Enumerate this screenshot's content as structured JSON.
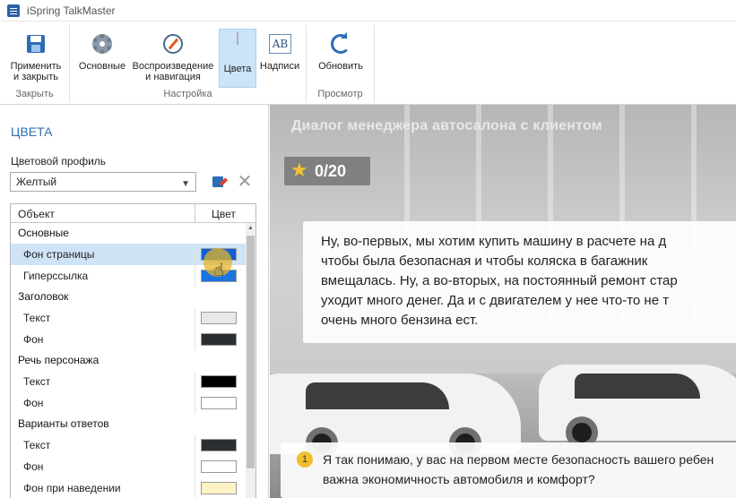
{
  "window": {
    "title": "iSpring TalkMaster",
    "icon": "app-icon"
  },
  "ribbon": {
    "groups": [
      {
        "label": "Закрыть",
        "buttons": [
          {
            "label": "Применить\nи закрыть",
            "icon": "save-close-icon"
          }
        ]
      },
      {
        "label": "Настройка",
        "buttons": [
          {
            "label": "Основные",
            "icon": "gear-icon"
          },
          {
            "label": "Воспроизведение\nи навигация",
            "icon": "compass-icon"
          },
          {
            "label": "Цвета",
            "icon": "colors-icon",
            "active": true
          },
          {
            "label": "Надписи",
            "icon": "text-ab-icon"
          }
        ]
      },
      {
        "label": "Просмотр",
        "buttons": [
          {
            "label": "Обновить",
            "icon": "refresh-icon"
          }
        ]
      }
    ]
  },
  "panel": {
    "title": "ЦВЕТА",
    "profile_label": "Цветовой профиль",
    "profile_value": "Желтый",
    "columns": {
      "object": "Объект",
      "color": "Цвет"
    },
    "rows": [
      {
        "type": "group",
        "label": "Основные"
      },
      {
        "type": "item",
        "label": "Фон страницы",
        "color": "#0f5fd4",
        "selected": true
      },
      {
        "type": "item",
        "label": "Гиперссылка",
        "color": "#1a73e0"
      },
      {
        "type": "group",
        "label": "Заголовок"
      },
      {
        "type": "item",
        "label": "Текст",
        "color": "#e8e8e8"
      },
      {
        "type": "item",
        "label": "Фон",
        "color": "#2b2f33"
      },
      {
        "type": "group",
        "label": "Речь персонажа"
      },
      {
        "type": "item",
        "label": "Текст",
        "color": "#000000"
      },
      {
        "type": "item",
        "label": "Фон",
        "color": "#ffffff"
      },
      {
        "type": "group",
        "label": "Варианты ответов"
      },
      {
        "type": "item",
        "label": "Текст",
        "color": "#2b2f33"
      },
      {
        "type": "item",
        "label": "Фон",
        "color": "#ffffff"
      },
      {
        "type": "item",
        "label": "Фон при наведении",
        "color": "#fdf3c4"
      }
    ]
  },
  "preview": {
    "dialog_title": "Диалог менеджера автосалона с клиентом",
    "score": "0/20",
    "speech_lines": [
      "Ну, во-первых, мы хотим купить машину в расчете на д",
      "чтобы была безопасная и чтобы коляска в багажник",
      "вмещалась. Ну, а во-вторых, на постоянный ремонт стар",
      "уходит много денег. Да и с двигателем у нее что-то не т",
      "очень много бензина ест."
    ],
    "answer_number": "1",
    "answer_lines": [
      "Я так понимаю, у вас на первом месте безопасность вашего ребен",
      "важна экономичность автомобиля и комфорт?"
    ]
  }
}
